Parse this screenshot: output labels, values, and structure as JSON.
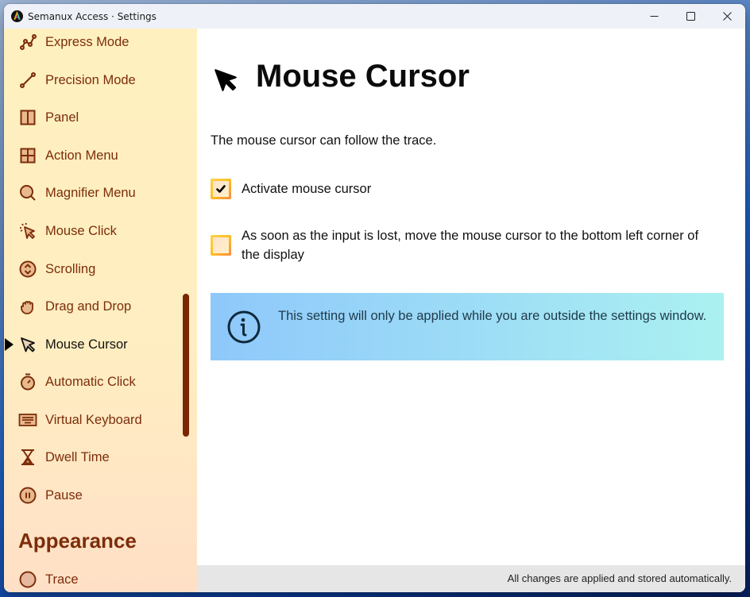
{
  "window": {
    "title": "Semanux Access · Settings",
    "controls": {
      "minimize": "minimize",
      "maximize": "maximize",
      "close": "close"
    }
  },
  "sidebar": {
    "items": [
      {
        "label": "Express Mode",
        "icon": "express-mode-icon"
      },
      {
        "label": "Precision Mode",
        "icon": "precision-mode-icon"
      },
      {
        "label": "Panel",
        "icon": "panel-icon"
      },
      {
        "label": "Action Menu",
        "icon": "action-menu-icon"
      },
      {
        "label": "Magnifier Menu",
        "icon": "magnifier-icon"
      },
      {
        "label": "Mouse Click",
        "icon": "mouse-click-icon"
      },
      {
        "label": "Scrolling",
        "icon": "scrolling-icon"
      },
      {
        "label": "Drag and Drop",
        "icon": "hand-icon"
      },
      {
        "label": "Mouse Cursor",
        "icon": "cursor-icon",
        "active": true
      },
      {
        "label": "Automatic Click",
        "icon": "stopwatch-icon"
      },
      {
        "label": "Virtual Keyboard",
        "icon": "keyboard-icon"
      },
      {
        "label": "Dwell Time",
        "icon": "hourglass-icon"
      },
      {
        "label": "Pause",
        "icon": "pause-icon"
      }
    ],
    "section_heading": "Appearance",
    "section_items": [
      {
        "label": "Trace",
        "icon": "trace-icon"
      }
    ]
  },
  "main": {
    "title": "Mouse Cursor",
    "description": "The mouse cursor can follow the trace.",
    "options": [
      {
        "label": "Activate mouse cursor",
        "checked": true
      },
      {
        "label": "As soon as the input is lost, move the mouse cursor to the bottom left corner of the display",
        "checked": false
      }
    ],
    "info": "This setting will only be applied while you are outside the settings window."
  },
  "footer": {
    "status": "All changes are applied and stored automatically."
  },
  "colors": {
    "accent": "#7c2d0b",
    "sidebar_bg": "#fff0bf",
    "checkbox_border": "#fbbf24",
    "info_bg_start": "#8ec8fb",
    "info_bg_end": "#abf1f1"
  }
}
